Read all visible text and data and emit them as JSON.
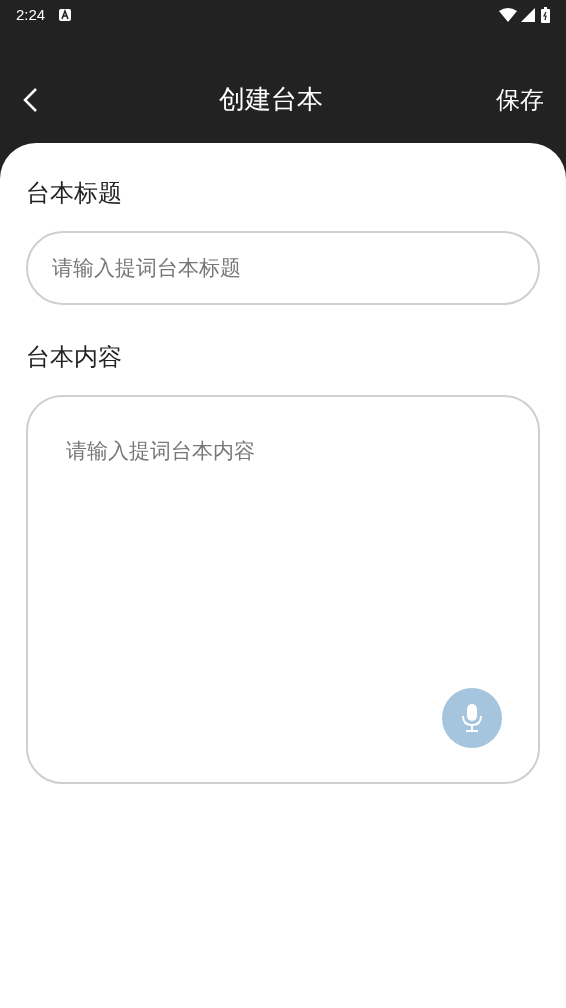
{
  "status_bar": {
    "time": "2:24"
  },
  "header": {
    "title": "创建台本",
    "action": "保存"
  },
  "title_section": {
    "label": "台本标题",
    "placeholder": "请输入提词台本标题"
  },
  "content_section": {
    "label": "台本内容",
    "placeholder": "请输入提词台本内容"
  }
}
